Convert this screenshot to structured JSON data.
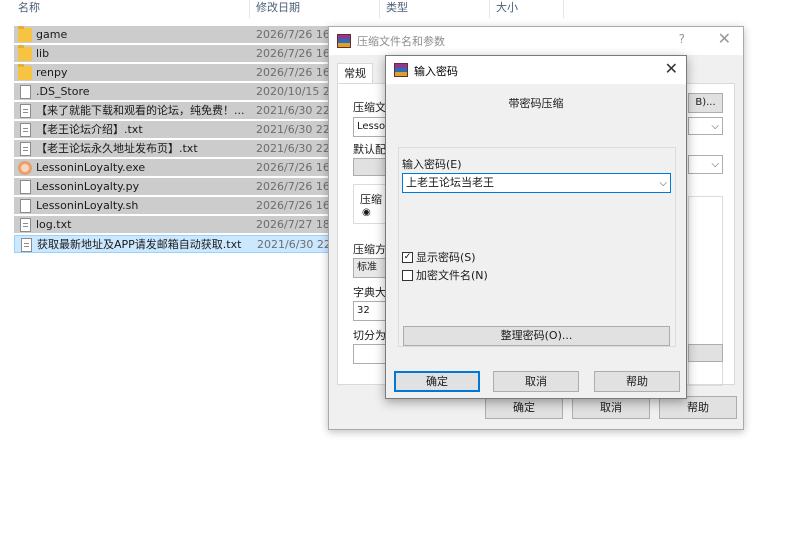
{
  "explorer": {
    "columns": [
      "名称",
      "修改日期",
      "类型",
      "大小"
    ],
    "files": [
      {
        "name": "game",
        "date": "2026/7/26 16:",
        "icon": "folder-icon"
      },
      {
        "name": "lib",
        "date": "2026/7/26 16:",
        "icon": "folder-icon"
      },
      {
        "name": "renpy",
        "date": "2026/7/26 16:",
        "icon": "folder-icon"
      },
      {
        "name": ".DS_Store",
        "date": "2020/10/15 23",
        "icon": "file-icon"
      },
      {
        "name": "【来了就能下载和观看的论坛，纯免费！...",
        "date": "2021/6/30 22:",
        "icon": "text-file-icon"
      },
      {
        "name": "【老王论坛介绍】.txt",
        "date": "2021/6/30 22:",
        "icon": "text-file-icon"
      },
      {
        "name": "【老王论坛永久地址发布页】.txt",
        "date": "2021/6/30 22:",
        "icon": "text-file-icon"
      },
      {
        "name": "LessoninLoyalty.exe",
        "date": "2026/7/26 16:",
        "icon": "app-icon"
      },
      {
        "name": "LessoninLoyalty.py",
        "date": "2026/7/26 16:",
        "icon": "file-icon"
      },
      {
        "name": "LessoninLoyalty.sh",
        "date": "2026/7/26 16:",
        "icon": "file-icon"
      },
      {
        "name": "log.txt",
        "date": "2026/7/27 18:",
        "icon": "text-file-icon"
      },
      {
        "name": "获取最新地址及APP请发邮箱自动获取.txt",
        "date": "2021/6/30 22:",
        "icon": "text-file-icon"
      }
    ]
  },
  "archive_dialog": {
    "title": "压缩文件名和参数",
    "help": "?",
    "close": "✕",
    "tab": "常规",
    "archive_name_label": "压缩文",
    "archive_name_value": "Lesson",
    "browse_button": "B)...",
    "default_profile_label": "默认配",
    "format_label": "压缩",
    "method_label": "压缩方",
    "method_value": "标准",
    "dict_label": "字典大",
    "dict_value": "32",
    "split_label": "切分为",
    "ok": "确定",
    "cancel": "取消",
    "help_button": "帮助"
  },
  "password_dialog": {
    "title": "输入密码",
    "close": "✕",
    "subtitle": "带密码压缩",
    "password_label": "输入密码(E)",
    "password_value": "上老王论坛当老王",
    "show_password": {
      "label": "显示密码(S)",
      "checked": true,
      "mark": "✓"
    },
    "encrypt_names": {
      "label": "加密文件名(N)",
      "checked": false,
      "mark": ""
    },
    "organize_button": "整理密码(O)...",
    "ok": "确定",
    "cancel": "取消",
    "help": "帮助"
  }
}
